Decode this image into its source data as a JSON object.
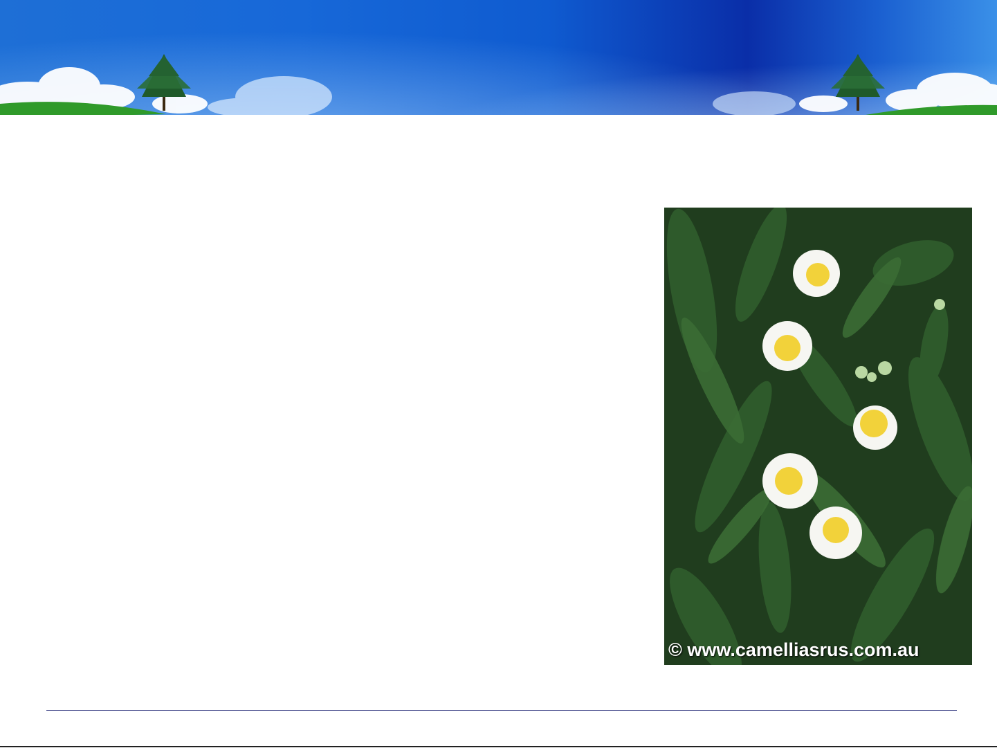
{
  "photo": {
    "caption": "© www.camelliasrus.com.au",
    "subject": "camellia-flower-photo"
  },
  "colors": {
    "banner_left": "#1e6fd6",
    "banner_mid": "#0a2ea8",
    "banner_right": "#3a90e8",
    "grass": "#2f9a2a",
    "divider": "#2a2f7a"
  }
}
